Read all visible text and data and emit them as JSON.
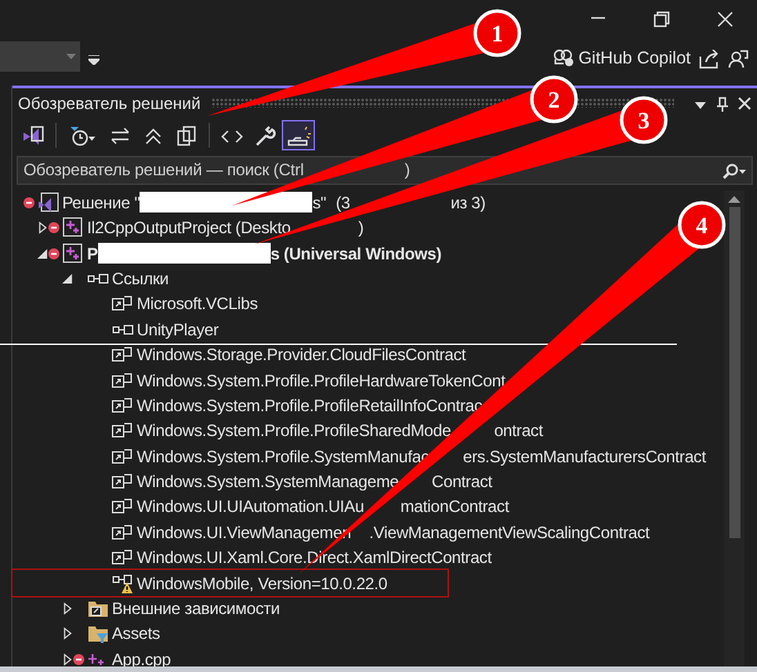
{
  "title_bar": {
    "copilot_label": "GitHub Copilot"
  },
  "panel": {
    "title": "Обозреватель решений",
    "toolbar": [
      {
        "kind": "solution",
        "selected": false
      },
      {
        "kind": "history",
        "selected": false
      },
      {
        "kind": "sync",
        "selected": false
      },
      {
        "kind": "collapse",
        "selected": false
      },
      {
        "kind": "copies",
        "selected": false
      },
      {
        "kind": "code",
        "selected": false
      },
      {
        "kind": "wrench",
        "selected": false
      },
      {
        "kind": "preview",
        "selected": true
      }
    ],
    "search": {
      "segments": [
        {
          "kind": "text",
          "text": "Обозреватель решений — поиск (Ctrl"
        },
        {
          "kind": "covered"
        },
        {
          "kind": "text",
          "text": ")"
        }
      ]
    },
    "tree": [
      {
        "kind": "solution",
        "excluded": true,
        "segments": [
          {
            "kind": "text",
            "text": "Решение \""
          },
          {
            "kind": "redaction"
          },
          {
            "kind": "text",
            "text": "s\""
          },
          {
            "kind": "text",
            "text": "(3"
          },
          {
            "kind": "covered"
          },
          {
            "kind": "text",
            "text": "из 3)"
          }
        ],
        "children": [
          {
            "kind": "project",
            "excluded": true,
            "expanded": false,
            "segments": [
              {
                "kind": "text",
                "text": "Il2CppOutputProject (Deskto"
              },
              {
                "kind": "covered"
              },
              {
                "kind": "text",
                "text": ")"
              }
            ]
          },
          {
            "kind": "project",
            "excluded": true,
            "expanded": true,
            "bold": true,
            "segments": [
              {
                "kind": "text",
                "text": "P"
              },
              {
                "kind": "redaction"
              },
              {
                "kind": "text",
                "text": "s (Universal Windows)"
              }
            ],
            "children": [
              {
                "kind": "references",
                "expanded": true,
                "segments": [
                  {
                    "kind": "text",
                    "text": "Ссылки"
                  }
                ],
                "children": [
                  {
                    "kind": "reference",
                    "segments": [
                      {
                        "kind": "text",
                        "text": "Microsoft.VCLibs"
                      }
                    ]
                  },
                  {
                    "kind": "assembly",
                    "segments": [
                      {
                        "kind": "text",
                        "text": "UnityPlayer"
                      }
                    ]
                  },
                  {
                    "kind": "reference",
                    "segments": [
                      {
                        "kind": "text",
                        "text": "Windows.Storage.Provider.CloudFilesContract"
                      }
                    ]
                  },
                  {
                    "kind": "reference",
                    "segments": [
                      {
                        "kind": "text",
                        "text": "Windows.System.Profile.ProfileHardwareTokenCont"
                      }
                    ]
                  },
                  {
                    "kind": "reference",
                    "segments": [
                      {
                        "kind": "text",
                        "text": "Windows.System.Profile.ProfileRetailInfoContrac"
                      }
                    ]
                  },
                  {
                    "kind": "reference",
                    "segments": [
                      {
                        "kind": "text",
                        "text": "Windows.System.Profile.ProfileSharedMode"
                      },
                      {
                        "kind": "covered"
                      },
                      {
                        "kind": "text",
                        "text": "ontract"
                      }
                    ]
                  },
                  {
                    "kind": "reference",
                    "segments": [
                      {
                        "kind": "text",
                        "text": "Windows.System.Profile.SystemManufac"
                      },
                      {
                        "kind": "covered"
                      },
                      {
                        "kind": "text",
                        "text": "ers.SystemManufacturersContract"
                      }
                    ]
                  },
                  {
                    "kind": "reference",
                    "segments": [
                      {
                        "kind": "text",
                        "text": "Windows.System.SystemManageme"
                      },
                      {
                        "kind": "covered"
                      },
                      {
                        "kind": "text",
                        "text": "Contract"
                      }
                    ]
                  },
                  {
                    "kind": "reference",
                    "segments": [
                      {
                        "kind": "text",
                        "text": "Windows.UI.UIAutomation.UIAu"
                      },
                      {
                        "kind": "covered"
                      },
                      {
                        "kind": "text",
                        "text": "mationContract"
                      }
                    ]
                  },
                  {
                    "kind": "reference",
                    "segments": [
                      {
                        "kind": "text",
                        "text": "Windows.UI.ViewManagemen"
                      },
                      {
                        "kind": "covered"
                      },
                      {
                        "kind": "text",
                        "text": ".ViewManagementViewScalingContract"
                      }
                    ]
                  },
                  {
                    "kind": "reference",
                    "segments": [
                      {
                        "kind": "text",
                        "text": "Windows.UI.Xaml.Core.Direct.XamlDirectContract"
                      }
                    ]
                  },
                  {
                    "kind": "warning",
                    "boxed": true,
                    "segments": [
                      {
                        "kind": "text",
                        "text": "WindowsMobile, Version=10.0.22.0"
                      }
                    ]
                  }
                ]
              },
              {
                "kind": "external",
                "expanded": false,
                "segments": [
                  {
                    "kind": "text",
                    "text": "Внешние зависимости"
                  }
                ]
              },
              {
                "kind": "filter",
                "expanded": false,
                "segments": [
                  {
                    "kind": "text",
                    "text": "Assets"
                  }
                ]
              },
              {
                "kind": "cpp",
                "excluded": true,
                "expanded": false,
                "segments": [
                  {
                    "kind": "text",
                    "text": "App.cpp"
                  }
                ]
              }
            ]
          }
        ]
      }
    ]
  },
  "callouts": [
    {
      "number": "1"
    },
    {
      "number": "2"
    },
    {
      "number": "3"
    },
    {
      "number": "4"
    }
  ]
}
